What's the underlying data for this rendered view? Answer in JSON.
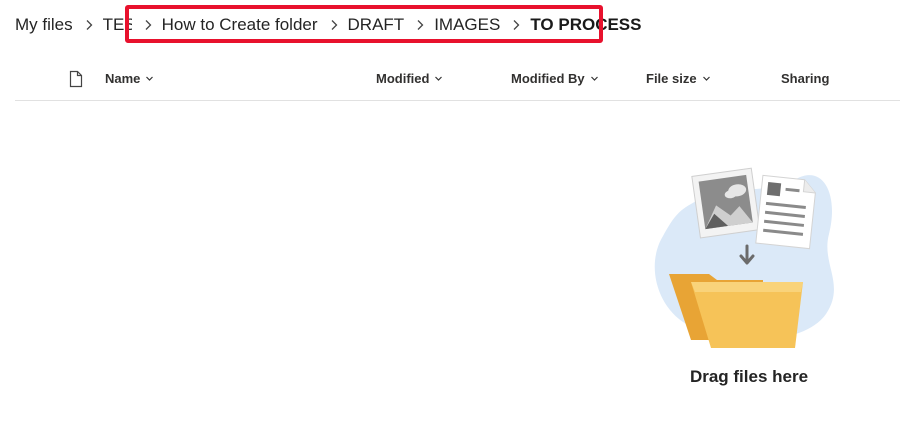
{
  "breadcrumb": {
    "items": [
      "My files",
      "TEST",
      "How to Create folder",
      "DRAFT",
      "IMAGES"
    ],
    "current": "TO PROCESS"
  },
  "columns": {
    "name": "Name",
    "modified": "Modified",
    "modified_by": "Modified By",
    "file_size": "File size",
    "sharing": "Sharing"
  },
  "empty_state": {
    "message": "Drag files here"
  },
  "colors": {
    "highlight": "#e8112d",
    "folder": "#f6c358",
    "blob": "#dbe9f8"
  }
}
